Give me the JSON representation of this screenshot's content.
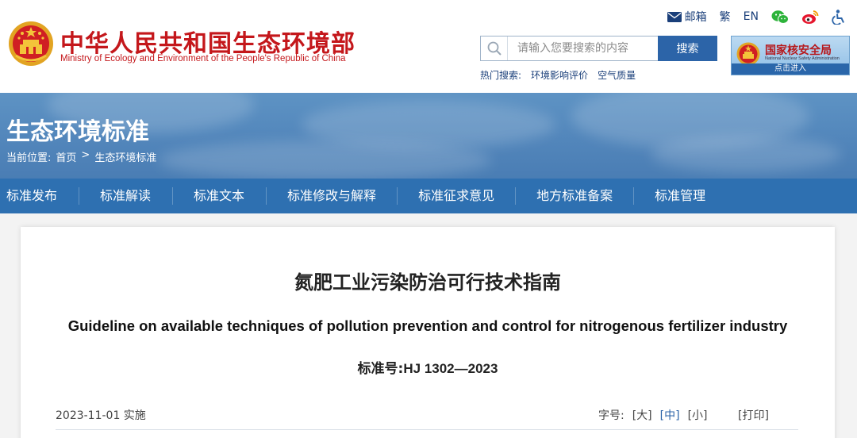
{
  "header": {
    "site_title": "中华人民共和国生态环境部",
    "site_subtitle": "Ministry of Ecology and Environment of the People's Republic of China",
    "utility": {
      "mail": "邮箱",
      "traditional": "繁",
      "english": "EN"
    },
    "search": {
      "placeholder": "请输入您要搜索的内容",
      "button": "搜索"
    },
    "hot_label": "热门搜索:",
    "hot_items": [
      "环境影响评价",
      "空气质量"
    ],
    "nnsa": {
      "title": "国家核安全局",
      "subtitle": "National Nuclear Safety Administration",
      "enter": "点击进入"
    }
  },
  "banner": {
    "title": "生态环境标准",
    "breadcrumb_label": "当前位置:",
    "breadcrumb": [
      "首页",
      ">",
      "生态环境标准"
    ]
  },
  "nav": [
    "标准发布",
    "标准解读",
    "标准文本",
    "标准修改与解释",
    "标准征求意见",
    "地方标准备案",
    "标准管理"
  ],
  "document": {
    "title_cn": "氮肥工业污染防治可行技术指南",
    "title_en": "Guideline on available techniques of pollution prevention and control for nitrogenous fertilizer industry",
    "std_label": "标准号:",
    "std_number": "HJ 1302—2023",
    "date": "2023-11-01 实施",
    "font_size_label": "字号:",
    "font_sizes": [
      "[大]",
      "[中]",
      "[小]"
    ],
    "print": "[打印]"
  },
  "colors": {
    "brand_red": "#c4171b",
    "nav_blue": "#2e70b1",
    "link_blue": "#1a3f7a"
  }
}
